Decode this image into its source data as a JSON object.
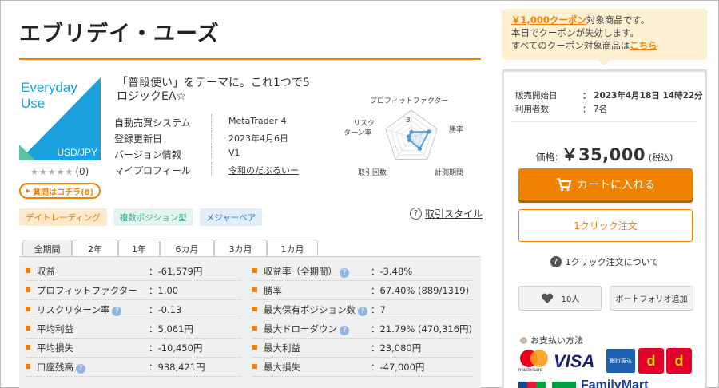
{
  "product": {
    "title": "エブリデイ・ユーズ",
    "thumbnail": {
      "name_line1": "Everyday",
      "name_line2": "Use",
      "pair": "USD/JPY",
      "accent_color": "#1aa0dc"
    },
    "rating": {
      "stars": "★★★★★",
      "count": "(0)"
    },
    "qa_button": "質問はコチラ(8)",
    "catch_copy": "「普段使い」をテーマに。これ1つで5ロジックEA☆"
  },
  "spec": {
    "rows": [
      {
        "key": "自動売買システム",
        "value": "MetaTrader 4"
      },
      {
        "key": "登録更新日",
        "value": "2023年4月6日"
      },
      {
        "key": "バージョン情報",
        "value": "V1"
      },
      {
        "key": "マイプロフィール",
        "value": "令和のだぶるいー"
      }
    ]
  },
  "radar": {
    "labels": {
      "profit_factor": "プロフィットファクター",
      "win_rate": "勝率",
      "period": "計測期間",
      "trades": "取引回数",
      "risk_return_1": "リスク",
      "risk_return_2": "ターン率"
    },
    "scale_label": "3",
    "values": {
      "profit_factor": 1.0,
      "win_rate": 3.4,
      "period": 2.6,
      "trades": 0.6,
      "risk_return": 0.5
    },
    "max": 5
  },
  "tags": [
    "デイトレーディング",
    "複数ポジション型",
    "メジャーペア"
  ],
  "trade_style": {
    "icon": "?",
    "label": "取引スタイル"
  },
  "tabs": [
    "全期間",
    "2年",
    "1年",
    "6カ月",
    "3カ月",
    "1カ月"
  ],
  "stats_left": [
    {
      "key": "収益",
      "value": "：-61,579円",
      "help": false
    },
    {
      "key": "プロフィットファクター",
      "value": "：1.00",
      "help": false
    },
    {
      "key": "リスクリターン率",
      "value": "：-0.13",
      "help": true
    },
    {
      "key": "平均利益",
      "value": "：5,061円",
      "help": false
    },
    {
      "key": "平均損失",
      "value": "：-10,450円",
      "help": false
    },
    {
      "key": "口座残高",
      "value": "：938,421円",
      "help": true
    }
  ],
  "stats_right": [
    {
      "key": "収益率（全期間）",
      "value": "：-3.48%",
      "help": true
    },
    {
      "key": "勝率",
      "value": "：67.40% (889/1319)",
      "help": false
    },
    {
      "key": "最大保有ポジション数",
      "value": "：7",
      "help": true
    },
    {
      "key": "最大ドローダウン",
      "value": "：21.79% (470,316円)",
      "help": true
    },
    {
      "key": "最大利益",
      "value": "：23,080円",
      "help": false
    },
    {
      "key": "最大損失",
      "value": "：-47,000円",
      "help": false
    }
  ],
  "help_glyph": "?",
  "coupon": {
    "highlight": "￥1,000クーポン",
    "line1_rest": "対象商品です。",
    "line2": "本日でクーポンが失効します。",
    "line3_prefix": "すべてのクーポン対象商品は",
    "line3_link": "こちら"
  },
  "sales": {
    "start_label": "販売開始日",
    "start_value": "：  2023年4月18日 14時22分",
    "users_label": "利用者数",
    "users_value": "：  7名"
  },
  "price": {
    "label": "価格:",
    "amount": "￥35,000",
    "tax": "(税込)"
  },
  "buttons": {
    "cart": "カートに入れる",
    "one_click": "1クリック注文",
    "one_click_help_icon": "?",
    "one_click_help": "1クリック注文について",
    "favorite_count": "10人",
    "portfolio": "ポートフォリオ追加"
  },
  "payment": {
    "title": "お支払い方法",
    "mastercard_text": "mastercard",
    "visa": "VISA",
    "bank": "銀行振込",
    "d1": "d",
    "d2": "d",
    "familymart": "FamilyMart"
  },
  "colors": {
    "accent": "#f08200",
    "stats_bg": "#f0f0f0",
    "coupon_bg": "#fdefd2"
  }
}
